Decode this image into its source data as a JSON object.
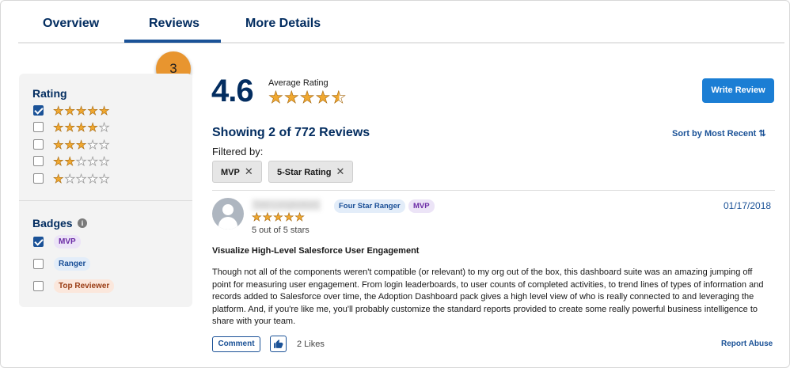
{
  "tabs": [
    {
      "label": "Overview"
    },
    {
      "label": "Reviews",
      "active": true
    },
    {
      "label": "More Details"
    }
  ],
  "callout_number": "3",
  "filters": {
    "rating_heading": "Rating",
    "rating_options": [
      {
        "stars": 5,
        "checked": true
      },
      {
        "stars": 4,
        "checked": false
      },
      {
        "stars": 3,
        "checked": false
      },
      {
        "stars": 2,
        "checked": false
      },
      {
        "stars": 1,
        "checked": false
      }
    ],
    "badges_heading": "Badges",
    "info_icon": "i",
    "badge_options": [
      {
        "label": "MVP",
        "checked": true
      },
      {
        "label": "Ranger",
        "checked": false
      },
      {
        "label": "Top Reviewer",
        "checked": false
      }
    ]
  },
  "summary": {
    "average_value": "4.6",
    "average_label": "Average Rating",
    "average_stars": 4.6,
    "write_review_label": "Write Review",
    "showing_text": "Showing 2 of 772 Reviews",
    "sort_label": "Sort by Most Recent ⇅",
    "filtered_by_label": "Filtered by:",
    "active_filters": [
      {
        "label": "MVP",
        "close": "✕"
      },
      {
        "label": "5-Star Rating",
        "close": "✕"
      }
    ]
  },
  "review": {
    "reviewer_name": "Tabi Longbottom",
    "reviewer_badges": [
      "Four Star Ranger",
      "MVP"
    ],
    "date": "01/17/2018",
    "stars": 5,
    "stars_text": "5 out of 5 stars",
    "title": "Visualize High-Level Salesforce User Engagement",
    "body": "Though not all of the components weren't compatible (or relevant) to my org out of the box, this dashboard suite was an amazing jumping off point for measuring user engagement. From login leaderboards, to user counts of completed activities, to trend lines of types of information and records added to Salesforce over time, the Adoption Dashboard pack gives a high level view of who is really connected to and leveraging the platform. And, if you're like me, you'll probably customize the standard reports provided to create some really powerful business intelligence to share with your team.",
    "comment_label": "Comment",
    "likes_text": "2 Likes",
    "report_label": "Report Abuse"
  },
  "colors": {
    "accent": "#1b5297",
    "heading": "#032d60",
    "star": "#f0a830",
    "callout": "#e8952f",
    "button": "#1b7ed4"
  },
  "icons": [
    "star-icon",
    "check-icon",
    "info-icon",
    "close-icon",
    "sort-icon",
    "user-avatar-icon",
    "thumbs-up-icon"
  ]
}
